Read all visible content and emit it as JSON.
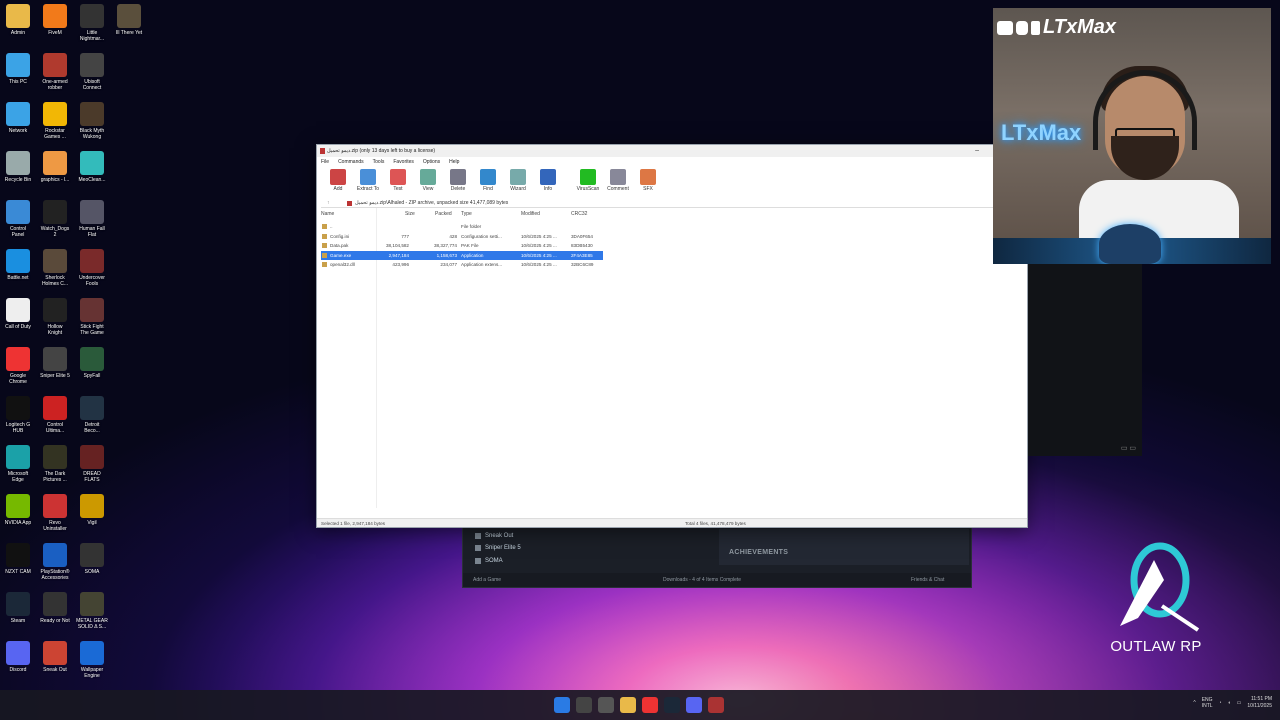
{
  "desktop_icons": [
    {
      "label": "Admin",
      "icon": "folder-icon",
      "color": "#e9b949"
    },
    {
      "label": "FiveM",
      "icon": "fivem-icon",
      "color": "#f27a1a"
    },
    {
      "label": "Little\nNightmar...",
      "icon": "game-icon",
      "color": "#333"
    },
    {
      "label": "Ill There Yet",
      "icon": "game-icon",
      "color": "#5a4f3c"
    },
    {
      "label": "This PC",
      "icon": "pc-icon",
      "color": "#3ba3e6"
    },
    {
      "label": "One-armed\nrobber",
      "icon": "game-icon",
      "color": "#b03a2e"
    },
    {
      "label": "Ubisoft\nConnect",
      "icon": "ubisoft-icon",
      "color": "#444"
    },
    {
      "label": "",
      "icon": "",
      "color": ""
    },
    {
      "label": "Network",
      "icon": "network-icon",
      "color": "#3ba3e6"
    },
    {
      "label": "Rockstar\nGames ...",
      "icon": "rockstar-icon",
      "color": "#f2b705"
    },
    {
      "label": "Black Myth\nWukong",
      "icon": "game-icon",
      "color": "#4b3a2a"
    },
    {
      "label": "",
      "icon": "",
      "color": ""
    },
    {
      "label": "Recycle Bin",
      "icon": "recycle-bin-icon",
      "color": "#9aa"
    },
    {
      "label": "graphics - l...",
      "icon": "file-icon",
      "color": "#e94"
    },
    {
      "label": "MeoClean...",
      "icon": "app-icon",
      "color": "#3bb"
    },
    {
      "label": "",
      "icon": "",
      "color": ""
    },
    {
      "label": "Control\nPanel",
      "icon": "control-panel-icon",
      "color": "#3a8ad6"
    },
    {
      "label": "Watch_Dogs\n2",
      "icon": "game-icon",
      "color": "#222"
    },
    {
      "label": "Human Fall\nFlat",
      "icon": "game-icon",
      "color": "#556"
    },
    {
      "label": "",
      "icon": "",
      "color": ""
    },
    {
      "label": "Battle.net",
      "icon": "battlenet-icon",
      "color": "#1a8fe0"
    },
    {
      "label": "Sherlock\nHolmes C...",
      "icon": "game-icon",
      "color": "#5a4a3a"
    },
    {
      "label": "Undercover\nFools",
      "icon": "game-icon",
      "color": "#7a2a2a"
    },
    {
      "label": "",
      "icon": "",
      "color": ""
    },
    {
      "label": "Call of Duty",
      "icon": "file-icon",
      "color": "#eee"
    },
    {
      "label": "Hollow\nKnight",
      "icon": "game-icon",
      "color": "#222"
    },
    {
      "label": "Stick Fight\nThe Game",
      "icon": "game-icon",
      "color": "#633"
    },
    {
      "label": "",
      "icon": "",
      "color": ""
    },
    {
      "label": "Google\nChrome",
      "icon": "chrome-icon",
      "color": "#e33"
    },
    {
      "label": "Sniper Elite 5",
      "icon": "game-icon",
      "color": "#444"
    },
    {
      "label": "SpyFall",
      "icon": "game-icon",
      "color": "#2a5a3a"
    },
    {
      "label": "",
      "icon": "",
      "color": ""
    },
    {
      "label": "Logitech G\nHUB",
      "icon": "logitech-icon",
      "color": "#111"
    },
    {
      "label": "Control\nUltima...",
      "icon": "game-icon",
      "color": "#c22"
    },
    {
      "label": "Detroit\nBeco...",
      "icon": "game-icon",
      "color": "#234"
    },
    {
      "label": "",
      "icon": "",
      "color": ""
    },
    {
      "label": "Microsoft\nEdge",
      "icon": "edge-icon",
      "color": "#1ba1a8"
    },
    {
      "label": "The Dark\nPictures ...",
      "icon": "game-icon",
      "color": "#332"
    },
    {
      "label": "DREAD\nFLATS",
      "icon": "game-icon",
      "color": "#622"
    },
    {
      "label": "",
      "icon": "",
      "color": ""
    },
    {
      "label": "NVIDIA App",
      "icon": "nvidia-icon",
      "color": "#76b900"
    },
    {
      "label": "Revo\nUninstaller",
      "icon": "app-icon",
      "color": "#c33"
    },
    {
      "label": "Vigil",
      "icon": "game-icon",
      "color": "#c90"
    },
    {
      "label": "",
      "icon": "",
      "color": ""
    },
    {
      "label": "NZXT CAM",
      "icon": "nzxt-icon",
      "color": "#111"
    },
    {
      "label": "PlayStation®\nAccessories",
      "icon": "playstation-icon",
      "color": "#1a5fc2"
    },
    {
      "label": "SOMA",
      "icon": "game-icon",
      "color": "#333"
    },
    {
      "label": "",
      "icon": "",
      "color": ""
    },
    {
      "label": "Steam",
      "icon": "steam-icon",
      "color": "#1b2838"
    },
    {
      "label": "Ready or Not",
      "icon": "game-icon",
      "color": "#333"
    },
    {
      "label": "METAL GEAR\nSOLID Δ S...",
      "icon": "game-icon",
      "color": "#443"
    },
    {
      "label": "",
      "icon": "",
      "color": ""
    },
    {
      "label": "Discord",
      "icon": "discord-icon",
      "color": "#5865f2"
    },
    {
      "label": "Sneak Out",
      "icon": "game-icon",
      "color": "#c43"
    },
    {
      "label": "Wallpaper\nEngine",
      "icon": "wallpaper-engine-icon",
      "color": "#1a6ad6"
    }
  ],
  "winrar": {
    "title": "ديمو تحميل.zip (only 13 days left to buy a license)",
    "menu": [
      "File",
      "Commands",
      "Tools",
      "Favorites",
      "Options",
      "Help"
    ],
    "toolbar": [
      {
        "label": "Add",
        "color": "#c44"
      },
      {
        "label": "Extract To",
        "color": "#4a8fd8"
      },
      {
        "label": "Test",
        "color": "#d55"
      },
      {
        "label": "View",
        "color": "#6a9"
      },
      {
        "label": "Delete",
        "color": "#778"
      },
      {
        "label": "Find",
        "color": "#38c"
      },
      {
        "label": "Wizard",
        "color": "#7aa"
      },
      {
        "label": "Info",
        "color": "#36b"
      },
      {
        "label": "VirusScan",
        "color": "#2b2"
      },
      {
        "label": "Comment",
        "color": "#889"
      },
      {
        "label": "SFX",
        "color": "#d74"
      }
    ],
    "path": "ديمو تحميل.zip\\Alhaled - ZIP archive, unpacked size 41,477,089 bytes",
    "columns": [
      "Name",
      "Size",
      "Packed",
      "Type",
      "Modified",
      "CRC32"
    ],
    "rows": [
      {
        "name": "..",
        "size": "",
        "packed": "",
        "type": "File folder",
        "modified": "",
        "crc": ""
      },
      {
        "name": "Config.ini",
        "size": "777",
        "packed": "428",
        "type": "Configuration setti...",
        "modified": "10/6/2025 4:25 ...",
        "crc": "3DA0F654"
      },
      {
        "name": "Data.pak",
        "size": "38,104,582",
        "packed": "38,327,774",
        "type": "PAK File",
        "modified": "10/6/2025 4:25 ...",
        "crc": "83DB5430"
      },
      {
        "name": "Game.exe",
        "size": "2,947,184",
        "packed": "1,158,673",
        "type": "Application",
        "modified": "10/6/2025 4:25 ...",
        "crc": "2F4A3E85"
      },
      {
        "name": "openal32.dll",
        "size": "423,996",
        "packed": "234,077",
        "type": "Application extens...",
        "modified": "10/6/2025 4:25 ...",
        "crc": "32BC6C89"
      }
    ],
    "selected_row": 3,
    "status_left": "Selected 1 file, 2,947,184 bytes",
    "status_right": "Total 4 files, 41,478,479 bytes"
  },
  "steam": {
    "items": [
      "Sneak Out",
      "Sniper Elite 5",
      "SOMA"
    ],
    "achievements": "ACHIEVEMENTS",
    "add_game": "Add a Game",
    "downloads": "Downloads - 4 of 4 Items Complete",
    "friends": "Friends & Chat"
  },
  "facecam": {
    "handle": "LTxMax",
    "neon": "LTxMax"
  },
  "logo_text": "OUTLAW RP",
  "taskbar": {
    "apps": [
      {
        "icon": "windows-start-icon",
        "color": "#2a7be4"
      },
      {
        "icon": "search-icon",
        "color": "#444"
      },
      {
        "icon": "task-view-icon",
        "color": "#555"
      },
      {
        "icon": "file-explorer-icon",
        "color": "#e9b949"
      },
      {
        "icon": "chrome-icon",
        "color": "#e33"
      },
      {
        "icon": "steam-icon",
        "color": "#1b2838"
      },
      {
        "icon": "discord-icon",
        "color": "#5865f2"
      },
      {
        "icon": "winrar-icon",
        "color": "#a33"
      }
    ],
    "lang": "ENG\nINTL",
    "time": "11:51 PM",
    "date": "10/11/2025"
  }
}
